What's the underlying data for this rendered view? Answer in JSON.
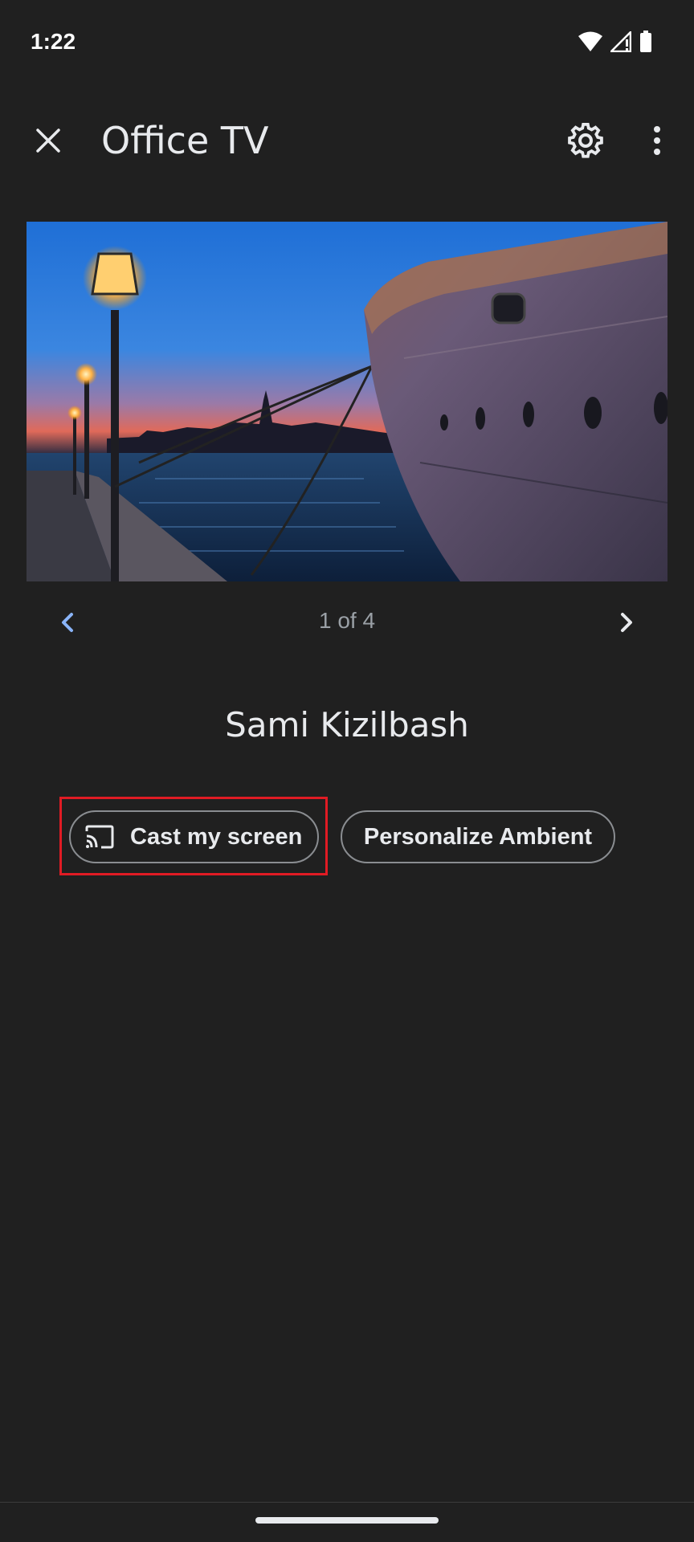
{
  "status_bar": {
    "time": "1:22",
    "icons": [
      "wifi-icon",
      "signal-icon",
      "battery-icon"
    ]
  },
  "app_bar": {
    "title": "Office TV",
    "close_icon": "close-icon",
    "settings_icon": "gear-icon",
    "more_icon": "more-vert-icon"
  },
  "hero": {
    "subject": "Harbor at dusk with street lamps and a ship's hull"
  },
  "pager": {
    "label": "1 of 4",
    "current": 1,
    "total": 4,
    "prev_icon": "chevron-left-icon",
    "next_icon": "chevron-right-icon"
  },
  "owner": {
    "name": "Sami Kizilbash"
  },
  "actions": {
    "cast_label": "Cast my screen",
    "cast_icon": "cast-icon",
    "personalize_label": "Personalize Ambient"
  },
  "colors": {
    "background": "#202020",
    "text_primary": "#e8eaed",
    "text_secondary": "#9aa0a6",
    "accent_blue": "#8ab4f8",
    "highlight_red": "#e01b24",
    "chip_border": "#8a8d91"
  }
}
